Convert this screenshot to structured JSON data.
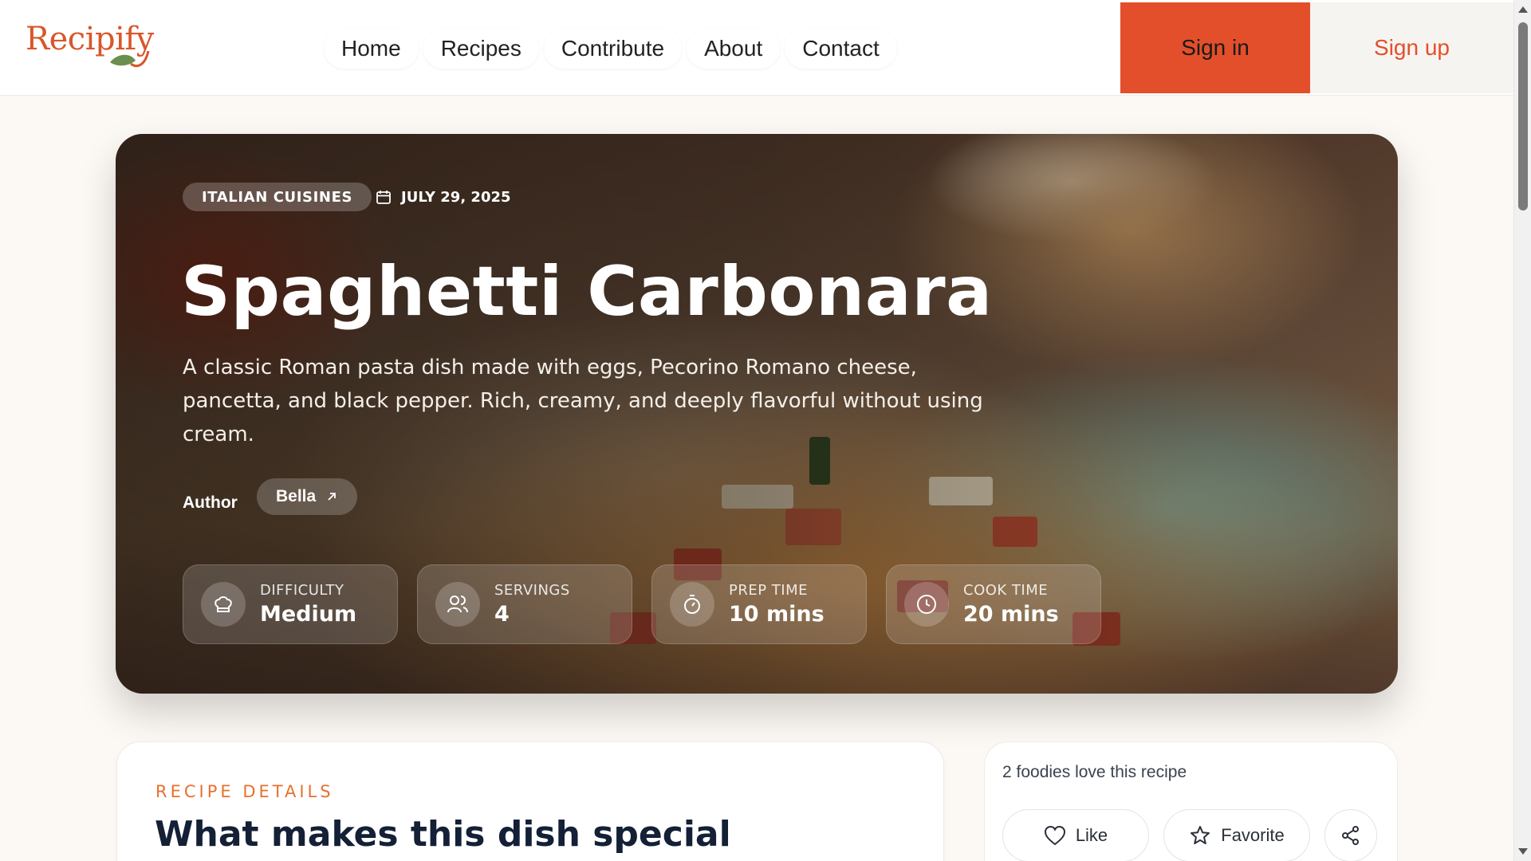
{
  "header": {
    "logo": "Recipify",
    "nav": [
      "Home",
      "Recipes",
      "Contribute",
      "About",
      "Contact"
    ],
    "signin_label": "Sign in",
    "signup_label": "Sign up"
  },
  "hero": {
    "cuisine": "ITALIAN CUISINES",
    "date": "JULY 29, 2025",
    "title": "Spaghetti Carbonara",
    "description": "A classic Roman pasta dish made with eggs, Pecorino Romano cheese, pancetta, and black pepper. Rich, creamy, and deeply flavorful without using cream.",
    "author_label": "Author",
    "author_name": "Bella",
    "stats": [
      {
        "label": "DIFFICULTY",
        "value": "Medium",
        "icon": "chef-hat-icon"
      },
      {
        "label": "SERVINGS",
        "value": "4",
        "icon": "users-icon"
      },
      {
        "label": "PREP TIME",
        "value": "10 mins",
        "icon": "timer-icon"
      },
      {
        "label": "COOK TIME",
        "value": "20 mins",
        "icon": "clock-icon"
      }
    ]
  },
  "details": {
    "eyebrow": "RECIPE DETAILS",
    "title": "What makes this dish special"
  },
  "social": {
    "love_text": "2 foodies love this recipe",
    "like_label": "Like",
    "favorite_label": "Favorite"
  },
  "colors": {
    "accent": "#e34f2a",
    "eyebrow": "#e8702f",
    "background": "#fcf9f4"
  }
}
